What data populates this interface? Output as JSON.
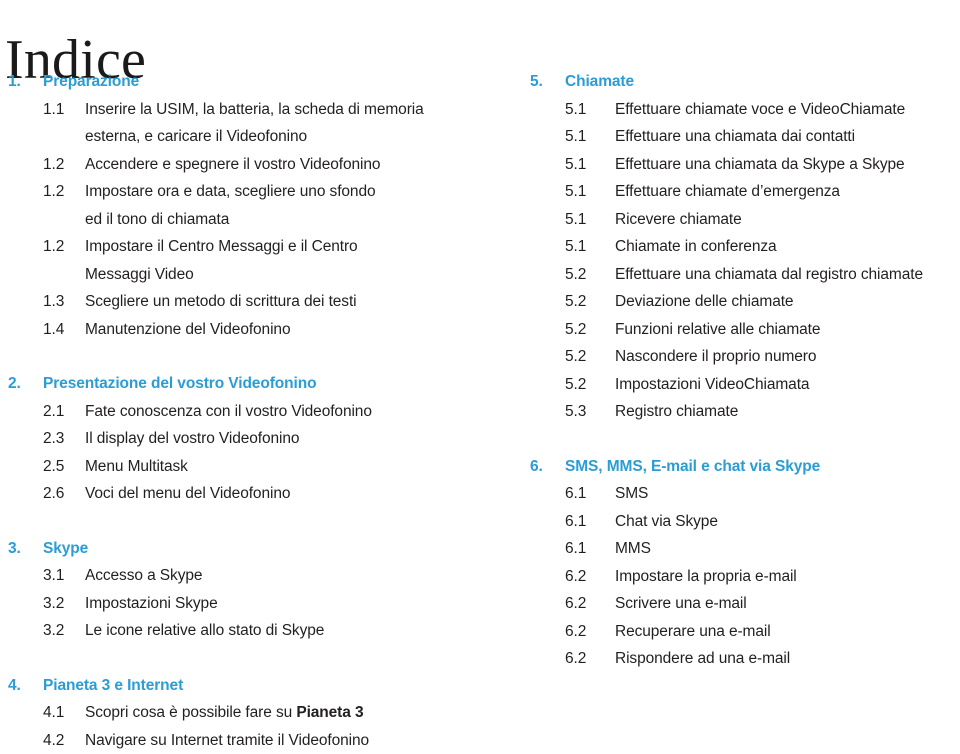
{
  "document": {
    "title": "Indice",
    "accent_color": "#2b9dd4",
    "text_color": "#231f20",
    "background_color": "#ffffff"
  },
  "columns": {
    "left": {
      "sections": [
        {
          "number": "1.",
          "title": "Preparazione",
          "items": [
            {
              "number": "1.1",
              "text": "Inserire la USIM, la batteria, la scheda di memoria",
              "text_line2": "esterna, e caricare il Videofonino"
            },
            {
              "number": "1.2",
              "text": "Accendere e spegnere il vostro Videofonino"
            },
            {
              "number": "1.2",
              "text": "Impostare ora e data, scegliere uno sfondo",
              "text_line2": "ed il tono di chiamata"
            },
            {
              "number": "1.2",
              "text": "Impostare il Centro Messaggi e il Centro",
              "text_line2": "Messaggi Video"
            },
            {
              "number": "1.3",
              "text": "Scegliere un metodo di scrittura dei testi"
            },
            {
              "number": "1.4",
              "text": "Manutenzione del Videofonino"
            }
          ]
        },
        {
          "number": "2.",
          "title": "Presentazione del vostro Videofonino",
          "items": [
            {
              "number": "2.1",
              "text": "Fate conoscenza con il vostro Videofonino"
            },
            {
              "number": "2.3",
              "text": "Il display del vostro Videofonino"
            },
            {
              "number": "2.5",
              "text": "Menu Multitask"
            },
            {
              "number": "2.6",
              "text": "Voci del menu del Videofonino"
            }
          ]
        },
        {
          "number": "3.",
          "title": "Skype",
          "items": [
            {
              "number": "3.1",
              "text": "Accesso a Skype"
            },
            {
              "number": "3.2",
              "text": "Impostazioni Skype"
            },
            {
              "number": "3.2",
              "text": "Le icone relative allo stato di Skype"
            }
          ]
        },
        {
          "number": "4.",
          "title": "Pianeta 3 e Internet",
          "items": [
            {
              "number": "4.1",
              "text": "Scopri cosa è possibile fare su ",
              "bold_suffix": "Pianeta 3"
            },
            {
              "number": "4.2",
              "text": "Navigare su Internet tramite il Videofonino"
            }
          ]
        }
      ]
    },
    "right": {
      "sections": [
        {
          "number": "5.",
          "title": "Chiamate",
          "items": [
            {
              "number": "5.1",
              "text": "Effettuare chiamate voce e VideoChiamate"
            },
            {
              "number": "5.1",
              "text": "Effettuare una chiamata dai contatti"
            },
            {
              "number": "5.1",
              "text": "Effettuare una chiamata da Skype a Skype"
            },
            {
              "number": "5.1",
              "text": "Effettuare chiamate d’emergenza"
            },
            {
              "number": "5.1",
              "text": "Ricevere chiamate"
            },
            {
              "number": "5.1",
              "text": "Chiamate in conferenza"
            },
            {
              "number": "5.2",
              "text": "Effettuare una chiamata dal registro chiamate"
            },
            {
              "number": "5.2",
              "text": "Deviazione delle chiamate"
            },
            {
              "number": "5.2",
              "text": "Funzioni relative alle chiamate"
            },
            {
              "number": "5.2",
              "text": "Nascondere il proprio numero"
            },
            {
              "number": "5.2",
              "text": "Impostazioni VideoChiamata"
            },
            {
              "number": "5.3",
              "text": "Registro chiamate"
            }
          ]
        },
        {
          "number": "6.",
          "title": "SMS, MMS, E-mail e chat via Skype",
          "items": [
            {
              "number": "6.1",
              "text": "SMS"
            },
            {
              "number": "6.1",
              "text": "Chat via Skype"
            },
            {
              "number": "6.1",
              "text": "MMS"
            },
            {
              "number": "6.2",
              "text": "Impostare la propria e-mail"
            },
            {
              "number": "6.2",
              "text": "Scrivere una e-mail"
            },
            {
              "number": "6.2",
              "text": "Recuperare una e-mail"
            },
            {
              "number": "6.2",
              "text": "Rispondere ad una e-mail"
            }
          ]
        }
      ]
    }
  }
}
